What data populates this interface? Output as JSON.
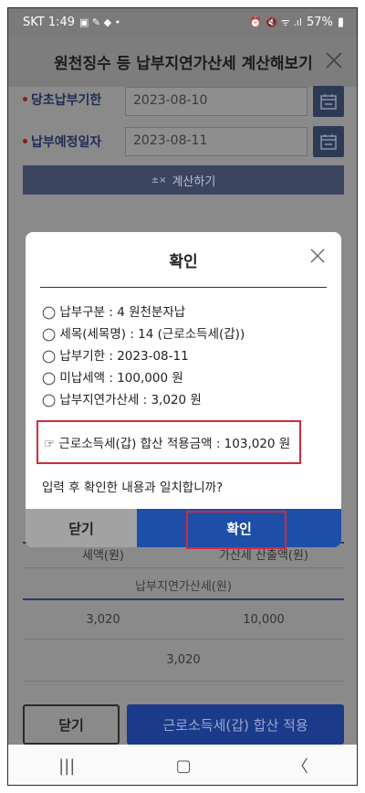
{
  "status_bar": {
    "carrier_time": "SKT 1:49",
    "battery": "57%"
  },
  "header": {
    "title": "원천징수 등 납부지연가산세 계산해보기"
  },
  "form": {
    "field1_label": "당초납부기한",
    "field1_value": "2023-08-10",
    "field2_label": "납부예정일자",
    "field2_value": "2023-08-11",
    "calc_button": "계산하기"
  },
  "background_table": {
    "col_left_header": "세액(원)",
    "col_right_header": "가산세 산출액(원)",
    "penalty_header": "납부지연가산세(원)",
    "left_value": "3,020",
    "right_value": "10,000",
    "total_value": "3,020"
  },
  "bottom": {
    "close_label": "닫기",
    "apply_label": "근로소득세(갑) 합산 적용"
  },
  "modal": {
    "title": "확인",
    "items": [
      "◯ 납부구분 : 4 원천분자납",
      "◯ 세목(세목명) : 14 (근로소득세(갑))",
      "◯ 납부기한 : 2023-08-11",
      "◯ 미납세액 : 100,000 원",
      "◯ 납부지연가산세 : 3,020 원"
    ],
    "highlight": "☞ 근로소득세(갑) 합산 적용금액 : 103,020 원",
    "question": "입력 후 확인한 내용과 일치합니까?",
    "close_button": "닫기",
    "ok_button": "확인"
  },
  "colors": {
    "primary": "#1d4fa8",
    "highlight_border": "#d02a3a",
    "label_navy": "#1e2c55"
  }
}
